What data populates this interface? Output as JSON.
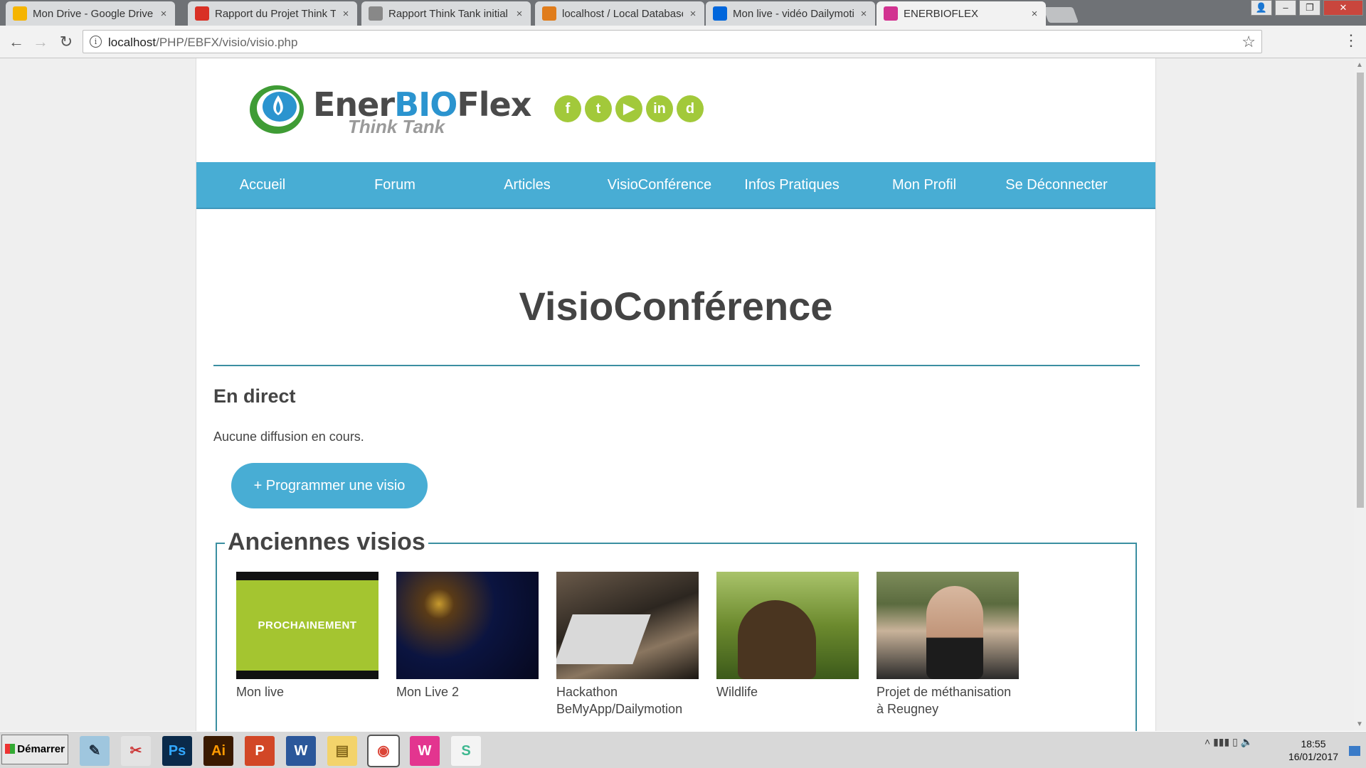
{
  "browser": {
    "tabs": [
      {
        "title": "Mon Drive - Google Drive",
        "icon": "google-drive-icon",
        "color": "#f5b400"
      },
      {
        "title": "Rapport du Projet Think Ta",
        "icon": "gmail-icon",
        "color": "#d93025"
      },
      {
        "title": "Rapport Think Tank initial",
        "icon": "document-icon",
        "color": "#888888"
      },
      {
        "title": "localhost / Local Database",
        "icon": "phpmyadmin-icon",
        "color": "#e07c1b"
      },
      {
        "title": "Mon live - vidéo Dailymotio",
        "icon": "dailymotion-icon",
        "color": "#0066dc"
      },
      {
        "title": "ENERBIOFLEX",
        "icon": "enerbioflex-icon",
        "color": "#d23391",
        "active": true
      }
    ],
    "close_glyph": "×",
    "url_host": "localhost",
    "url_path": "/PHP/EBFX/visio/visio.php"
  },
  "site": {
    "logo": {
      "ener": "Ener",
      "bio": "BIO",
      "flex": "Flex",
      "tagline": "Think Tank"
    },
    "socials": [
      {
        "icon": "facebook-icon",
        "glyph": "f"
      },
      {
        "icon": "twitter-icon",
        "glyph": "t"
      },
      {
        "icon": "youtube-icon",
        "glyph": "▶"
      },
      {
        "icon": "linkedin-icon",
        "glyph": "in"
      },
      {
        "icon": "dailymotion-icon",
        "glyph": "d"
      }
    ],
    "nav": [
      "Accueil",
      "Forum",
      "Articles",
      "VisioConférence",
      "Infos Pratiques",
      "Mon Profil",
      "Se Déconnecter"
    ],
    "accent": "#48add4",
    "rule_color": "#3b8fa1"
  },
  "content": {
    "title": "VisioConférence",
    "live_heading": "En direct",
    "no_broadcast": "Aucune diffusion en cours.",
    "schedule_button": "+ Programmer une visio",
    "past_heading": "Anciennes visios",
    "videos": [
      {
        "label": "Mon live",
        "thumb_text": "PROCHAINEMENT"
      },
      {
        "label": "Mon Live 2"
      },
      {
        "label": "Hackathon BeMyApp/Dailymotion"
      },
      {
        "label": "Wildlife"
      },
      {
        "label": "Projet de méthanisation à Reugney"
      }
    ]
  },
  "taskbar": {
    "start_label": "Démarrer",
    "apps": [
      {
        "name": "notepad-icon",
        "glyph": "✎",
        "bg": "#9fc6de",
        "fg": "#234"
      },
      {
        "name": "snipping-tool-icon",
        "glyph": "✂",
        "bg": "#e3e3e3",
        "fg": "#c33"
      },
      {
        "name": "photoshop-icon",
        "glyph": "Ps",
        "bg": "#0a2a4a",
        "fg": "#31a8ff"
      },
      {
        "name": "illustrator-icon",
        "glyph": "Ai",
        "bg": "#3a1a00",
        "fg": "#ff9a00"
      },
      {
        "name": "powerpoint-icon",
        "glyph": "P",
        "bg": "#d24726",
        "fg": "#fff"
      },
      {
        "name": "word-icon",
        "glyph": "W",
        "bg": "#2b579a",
        "fg": "#fff"
      },
      {
        "name": "file-explorer-icon",
        "glyph": "▤",
        "bg": "#f3d36b",
        "fg": "#8a6d1d"
      },
      {
        "name": "chrome-icon",
        "glyph": "◉",
        "bg": "#ffffff",
        "fg": "#db4437",
        "selected": true
      },
      {
        "name": "wamp-icon",
        "glyph": "W",
        "bg": "#e3358f",
        "fg": "#fff"
      },
      {
        "name": "slack-icon",
        "glyph": "S",
        "bg": "#f4f4f4",
        "fg": "#3eb890"
      }
    ],
    "tray_glyphs": "˄  ▮▮▮  ▯  🔈",
    "time": "18:55",
    "date": "16/01/2017"
  }
}
